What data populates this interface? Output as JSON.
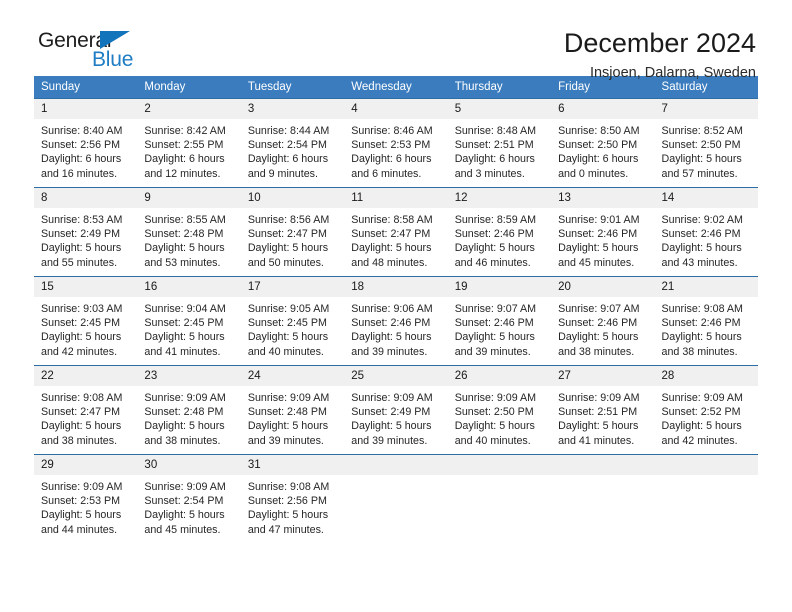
{
  "logo": {
    "word_top": "General",
    "word_bottom": "Blue",
    "accent_color": "#1275bc"
  },
  "header": {
    "title": "December 2024",
    "subtitle": "Insjoen, Dalarna, Sweden"
  },
  "calendar": {
    "header_bg": "#3a7cbe",
    "weekdays": [
      "Sunday",
      "Monday",
      "Tuesday",
      "Wednesday",
      "Thursday",
      "Friday",
      "Saturday"
    ],
    "weeks": [
      [
        {
          "day": "1",
          "sunrise": "Sunrise: 8:40 AM",
          "sunset": "Sunset: 2:56 PM",
          "daylight1": "Daylight: 6 hours",
          "daylight2": "and 16 minutes."
        },
        {
          "day": "2",
          "sunrise": "Sunrise: 8:42 AM",
          "sunset": "Sunset: 2:55 PM",
          "daylight1": "Daylight: 6 hours",
          "daylight2": "and 12 minutes."
        },
        {
          "day": "3",
          "sunrise": "Sunrise: 8:44 AM",
          "sunset": "Sunset: 2:54 PM",
          "daylight1": "Daylight: 6 hours",
          "daylight2": "and 9 minutes."
        },
        {
          "day": "4",
          "sunrise": "Sunrise: 8:46 AM",
          "sunset": "Sunset: 2:53 PM",
          "daylight1": "Daylight: 6 hours",
          "daylight2": "and 6 minutes."
        },
        {
          "day": "5",
          "sunrise": "Sunrise: 8:48 AM",
          "sunset": "Sunset: 2:51 PM",
          "daylight1": "Daylight: 6 hours",
          "daylight2": "and 3 minutes."
        },
        {
          "day": "6",
          "sunrise": "Sunrise: 8:50 AM",
          "sunset": "Sunset: 2:50 PM",
          "daylight1": "Daylight: 6 hours",
          "daylight2": "and 0 minutes."
        },
        {
          "day": "7",
          "sunrise": "Sunrise: 8:52 AM",
          "sunset": "Sunset: 2:50 PM",
          "daylight1": "Daylight: 5 hours",
          "daylight2": "and 57 minutes."
        }
      ],
      [
        {
          "day": "8",
          "sunrise": "Sunrise: 8:53 AM",
          "sunset": "Sunset: 2:49 PM",
          "daylight1": "Daylight: 5 hours",
          "daylight2": "and 55 minutes."
        },
        {
          "day": "9",
          "sunrise": "Sunrise: 8:55 AM",
          "sunset": "Sunset: 2:48 PM",
          "daylight1": "Daylight: 5 hours",
          "daylight2": "and 53 minutes."
        },
        {
          "day": "10",
          "sunrise": "Sunrise: 8:56 AM",
          "sunset": "Sunset: 2:47 PM",
          "daylight1": "Daylight: 5 hours",
          "daylight2": "and 50 minutes."
        },
        {
          "day": "11",
          "sunrise": "Sunrise: 8:58 AM",
          "sunset": "Sunset: 2:47 PM",
          "daylight1": "Daylight: 5 hours",
          "daylight2": "and 48 minutes."
        },
        {
          "day": "12",
          "sunrise": "Sunrise: 8:59 AM",
          "sunset": "Sunset: 2:46 PM",
          "daylight1": "Daylight: 5 hours",
          "daylight2": "and 46 minutes."
        },
        {
          "day": "13",
          "sunrise": "Sunrise: 9:01 AM",
          "sunset": "Sunset: 2:46 PM",
          "daylight1": "Daylight: 5 hours",
          "daylight2": "and 45 minutes."
        },
        {
          "day": "14",
          "sunrise": "Sunrise: 9:02 AM",
          "sunset": "Sunset: 2:46 PM",
          "daylight1": "Daylight: 5 hours",
          "daylight2": "and 43 minutes."
        }
      ],
      [
        {
          "day": "15",
          "sunrise": "Sunrise: 9:03 AM",
          "sunset": "Sunset: 2:45 PM",
          "daylight1": "Daylight: 5 hours",
          "daylight2": "and 42 minutes."
        },
        {
          "day": "16",
          "sunrise": "Sunrise: 9:04 AM",
          "sunset": "Sunset: 2:45 PM",
          "daylight1": "Daylight: 5 hours",
          "daylight2": "and 41 minutes."
        },
        {
          "day": "17",
          "sunrise": "Sunrise: 9:05 AM",
          "sunset": "Sunset: 2:45 PM",
          "daylight1": "Daylight: 5 hours",
          "daylight2": "and 40 minutes."
        },
        {
          "day": "18",
          "sunrise": "Sunrise: 9:06 AM",
          "sunset": "Sunset: 2:46 PM",
          "daylight1": "Daylight: 5 hours",
          "daylight2": "and 39 minutes."
        },
        {
          "day": "19",
          "sunrise": "Sunrise: 9:07 AM",
          "sunset": "Sunset: 2:46 PM",
          "daylight1": "Daylight: 5 hours",
          "daylight2": "and 39 minutes."
        },
        {
          "day": "20",
          "sunrise": "Sunrise: 9:07 AM",
          "sunset": "Sunset: 2:46 PM",
          "daylight1": "Daylight: 5 hours",
          "daylight2": "and 38 minutes."
        },
        {
          "day": "21",
          "sunrise": "Sunrise: 9:08 AM",
          "sunset": "Sunset: 2:46 PM",
          "daylight1": "Daylight: 5 hours",
          "daylight2": "and 38 minutes."
        }
      ],
      [
        {
          "day": "22",
          "sunrise": "Sunrise: 9:08 AM",
          "sunset": "Sunset: 2:47 PM",
          "daylight1": "Daylight: 5 hours",
          "daylight2": "and 38 minutes."
        },
        {
          "day": "23",
          "sunrise": "Sunrise: 9:09 AM",
          "sunset": "Sunset: 2:48 PM",
          "daylight1": "Daylight: 5 hours",
          "daylight2": "and 38 minutes."
        },
        {
          "day": "24",
          "sunrise": "Sunrise: 9:09 AM",
          "sunset": "Sunset: 2:48 PM",
          "daylight1": "Daylight: 5 hours",
          "daylight2": "and 39 minutes."
        },
        {
          "day": "25",
          "sunrise": "Sunrise: 9:09 AM",
          "sunset": "Sunset: 2:49 PM",
          "daylight1": "Daylight: 5 hours",
          "daylight2": "and 39 minutes."
        },
        {
          "day": "26",
          "sunrise": "Sunrise: 9:09 AM",
          "sunset": "Sunset: 2:50 PM",
          "daylight1": "Daylight: 5 hours",
          "daylight2": "and 40 minutes."
        },
        {
          "day": "27",
          "sunrise": "Sunrise: 9:09 AM",
          "sunset": "Sunset: 2:51 PM",
          "daylight1": "Daylight: 5 hours",
          "daylight2": "and 41 minutes."
        },
        {
          "day": "28",
          "sunrise": "Sunrise: 9:09 AM",
          "sunset": "Sunset: 2:52 PM",
          "daylight1": "Daylight: 5 hours",
          "daylight2": "and 42 minutes."
        }
      ],
      [
        {
          "day": "29",
          "sunrise": "Sunrise: 9:09 AM",
          "sunset": "Sunset: 2:53 PM",
          "daylight1": "Daylight: 5 hours",
          "daylight2": "and 44 minutes."
        },
        {
          "day": "30",
          "sunrise": "Sunrise: 9:09 AM",
          "sunset": "Sunset: 2:54 PM",
          "daylight1": "Daylight: 5 hours",
          "daylight2": "and 45 minutes."
        },
        {
          "day": "31",
          "sunrise": "Sunrise: 9:08 AM",
          "sunset": "Sunset: 2:56 PM",
          "daylight1": "Daylight: 5 hours",
          "daylight2": "and 47 minutes."
        },
        {
          "day": "",
          "sunrise": "",
          "sunset": "",
          "daylight1": "",
          "daylight2": ""
        },
        {
          "day": "",
          "sunrise": "",
          "sunset": "",
          "daylight1": "",
          "daylight2": ""
        },
        {
          "day": "",
          "sunrise": "",
          "sunset": "",
          "daylight1": "",
          "daylight2": ""
        },
        {
          "day": "",
          "sunrise": "",
          "sunset": "",
          "daylight1": "",
          "daylight2": ""
        }
      ]
    ]
  }
}
